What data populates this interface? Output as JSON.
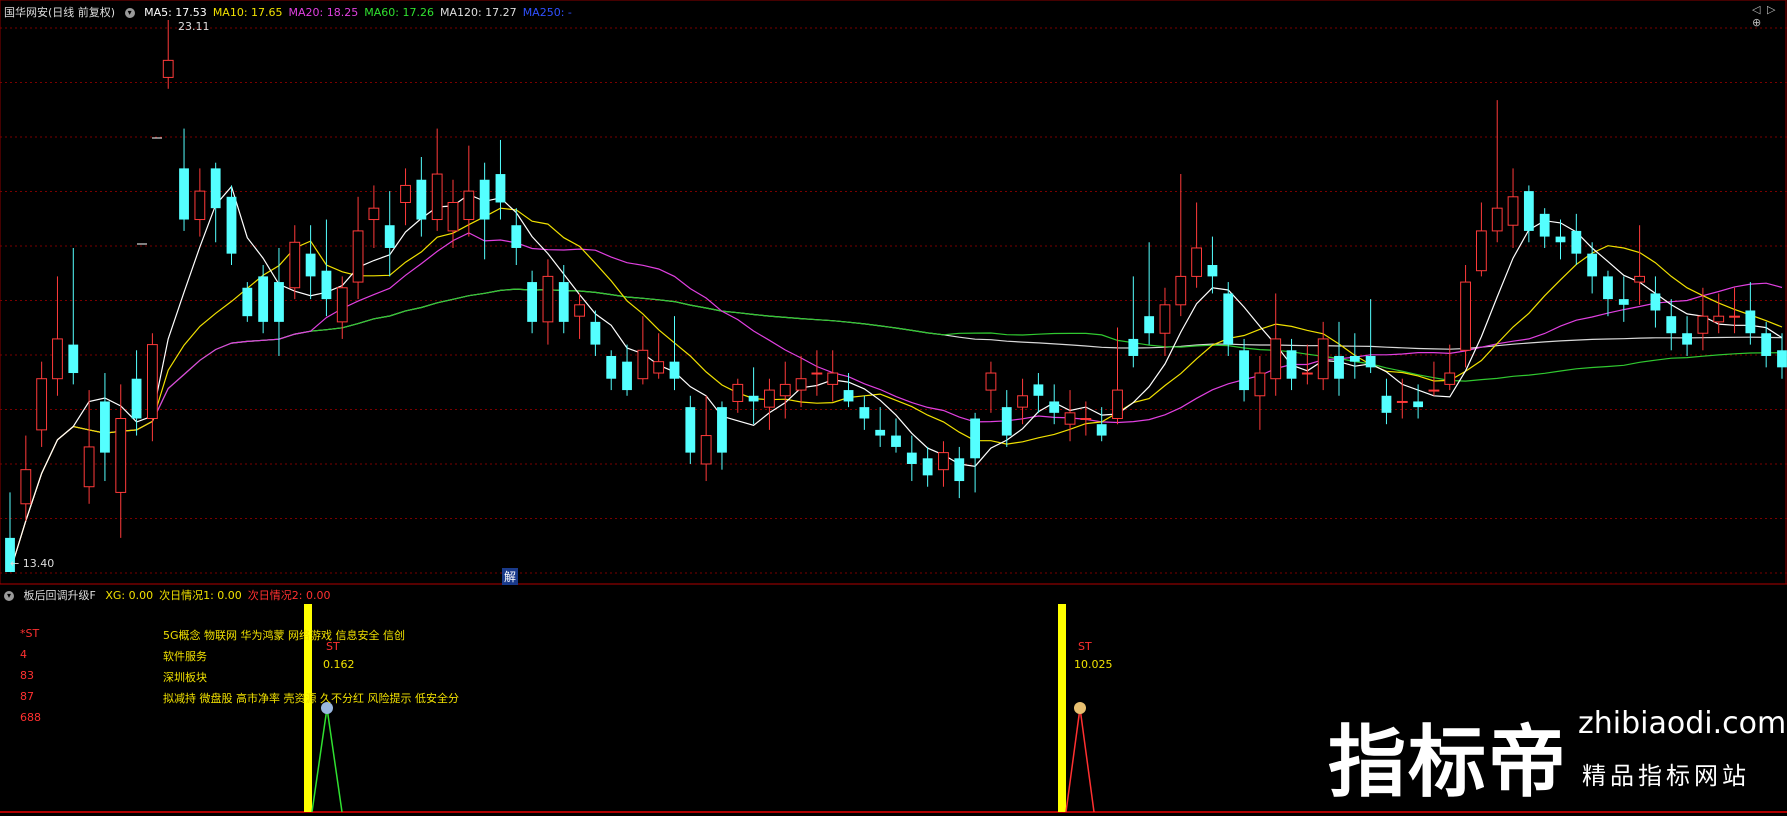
{
  "top_panel": {
    "stock_title": "国华网安(日线 前复权)",
    "ma_labels": [
      {
        "text": "MA5: 17.53",
        "color": "#ffffff"
      },
      {
        "text": "MA10: 17.65",
        "color": "#f0e000"
      },
      {
        "text": "MA20: 18.25",
        "color": "#e040e0"
      },
      {
        "text": "MA60: 17.26",
        "color": "#30e030"
      },
      {
        "text": "MA120: 17.27",
        "color": "#dddddd"
      },
      {
        "text": "MA250: -",
        "color": "#3050ff"
      }
    ],
    "high_label": "23.11",
    "low_label": "13.40",
    "jie_label": "解",
    "side_buttons": [
      "◁",
      "▷",
      "⊕"
    ]
  },
  "bottom_panel": {
    "indicator_title": "板后回调升级F",
    "indicator_values": [
      {
        "text": "XG: 0.00",
        "color": "#f0e000"
      },
      {
        "text": "次日情况1: 0.00",
        "color": "#f0e000"
      },
      {
        "text": "次日情况2: 0.00",
        "color": "#ff3030"
      }
    ],
    "left_info": [
      "*ST",
      "4",
      "83",
      "87",
      "688"
    ],
    "concepts": [
      "5G概念 物联网 华为鸿蒙 网络游戏 信息安全 信创",
      "软件服务",
      "深圳板块",
      "拟减持 微盘股 高市净率 壳资源 久不分红 风险提示 低安全分"
    ],
    "signals": [
      {
        "label": "ST",
        "value": "0.162"
      },
      {
        "label": "ST",
        "value": "10.025"
      }
    ]
  },
  "watermark": {
    "big_text": "指标帝",
    "url": "zhibiaodi.com",
    "sub_text": "精品指标网站"
  },
  "colors": {
    "up": "#ff3a3a",
    "down": "#54ffff",
    "ma5": "#ffffff",
    "ma10": "#f0e000",
    "ma20": "#e040e0",
    "ma60": "#30c830",
    "ma120": "#d8d8d8",
    "grid": "#7a0000",
    "signal_bar": "#ffff00"
  },
  "chart_data": {
    "type": "candlestick",
    "price_range": [
      13.4,
      23.11
    ],
    "candles": [
      [
        14.0,
        13.4,
        14.8,
        13.4
      ],
      [
        14.6,
        15.2,
        15.8,
        14.3
      ],
      [
        15.9,
        16.8,
        17.1,
        15.6
      ],
      [
        16.8,
        17.5,
        18.6,
        16.5
      ],
      [
        17.4,
        16.9,
        19.1,
        16.7
      ],
      [
        14.9,
        15.6,
        16.6,
        14.6
      ],
      [
        16.4,
        15.5,
        16.9,
        15.0
      ],
      [
        14.8,
        16.1,
        16.7,
        14.0
      ],
      [
        16.8,
        16.1,
        17.3,
        15.8
      ],
      [
        16.1,
        17.4,
        17.6,
        15.7
      ],
      [
        22.1,
        22.4,
        23.11,
        21.9
      ],
      [
        20.5,
        19.6,
        21.2,
        19.4
      ],
      [
        19.6,
        20.1,
        20.5,
        19.3
      ],
      [
        20.5,
        19.8,
        20.6,
        19.2
      ],
      [
        20.0,
        19.0,
        20.2,
        18.8
      ],
      [
        18.4,
        17.9,
        18.5,
        17.8
      ],
      [
        18.6,
        17.8,
        18.8,
        17.6
      ],
      [
        18.5,
        17.8,
        19.1,
        17.2
      ],
      [
        18.4,
        19.2,
        19.5,
        18.2
      ],
      [
        19.0,
        18.6,
        19.5,
        18.2
      ],
      [
        18.7,
        18.2,
        19.6,
        17.9
      ],
      [
        17.8,
        18.4,
        18.6,
        17.5
      ],
      [
        18.5,
        19.4,
        20.0,
        18.2
      ],
      [
        19.6,
        19.8,
        20.2,
        19.1
      ],
      [
        19.5,
        19.1,
        20.1,
        18.6
      ],
      [
        19.9,
        20.2,
        20.5,
        19.5
      ],
      [
        20.3,
        19.6,
        20.7,
        19.3
      ],
      [
        19.6,
        20.4,
        21.2,
        19.4
      ],
      [
        19.4,
        19.9,
        20.3,
        19.1
      ],
      [
        19.6,
        20.1,
        20.9,
        19.3
      ],
      [
        20.3,
        19.6,
        20.6,
        18.9
      ],
      [
        20.4,
        19.9,
        21.0,
        19.6
      ],
      [
        19.5,
        19.1,
        19.8,
        18.8
      ],
      [
        18.5,
        17.8,
        18.7,
        17.6
      ],
      [
        17.8,
        18.6,
        18.9,
        17.4
      ],
      [
        18.5,
        17.8,
        18.8,
        17.6
      ],
      [
        17.9,
        18.1,
        18.3,
        17.5
      ],
      [
        17.8,
        17.4,
        18.0,
        17.2
      ],
      [
        17.2,
        16.8,
        17.3,
        16.6
      ],
      [
        17.1,
        16.6,
        17.4,
        16.5
      ],
      [
        16.8,
        17.3,
        17.9,
        16.7
      ],
      [
        16.9,
        17.1,
        17.6,
        16.8
      ],
      [
        17.1,
        16.8,
        17.9,
        16.6
      ],
      [
        16.3,
        15.5,
        16.5,
        15.3
      ],
      [
        15.3,
        15.8,
        16.5,
        15.0
      ],
      [
        16.3,
        15.5,
        16.4,
        15.2
      ],
      [
        16.4,
        16.7,
        16.8,
        16.2
      ],
      [
        16.5,
        16.4,
        17.0,
        16.0
      ],
      [
        16.3,
        16.6,
        16.8,
        15.9
      ],
      [
        16.5,
        16.7,
        17.1,
        16.1
      ],
      [
        16.6,
        16.8,
        17.2,
        16.3
      ],
      [
        16.9,
        16.9,
        17.3,
        16.5
      ],
      [
        16.7,
        16.9,
        17.3,
        16.4
      ],
      [
        16.6,
        16.4,
        16.9,
        16.3
      ],
      [
        16.3,
        16.1,
        16.5,
        15.9
      ],
      [
        15.9,
        15.8,
        16.3,
        15.6
      ],
      [
        15.8,
        15.6,
        16.1,
        15.5
      ],
      [
        15.5,
        15.3,
        15.8,
        15.0
      ],
      [
        15.4,
        15.1,
        15.6,
        14.9
      ],
      [
        15.2,
        15.5,
        15.7,
        14.9
      ],
      [
        15.4,
        15.0,
        15.6,
        14.7
      ],
      [
        16.1,
        15.4,
        16.2,
        14.8
      ],
      [
        16.6,
        16.9,
        17.1,
        16.2
      ],
      [
        16.3,
        15.8,
        16.6,
        15.6
      ],
      [
        16.3,
        16.5,
        16.8,
        16.0
      ],
      [
        16.7,
        16.5,
        16.9,
        16.2
      ],
      [
        16.4,
        16.2,
        16.7,
        16.0
      ],
      [
        16.0,
        16.2,
        16.6,
        15.7
      ],
      [
        16.1,
        16.1,
        16.4,
        15.8
      ],
      [
        16.0,
        15.8,
        16.3,
        15.7
      ],
      [
        16.1,
        16.6,
        17.7,
        16.0
      ],
      [
        17.5,
        17.2,
        18.6,
        17.0
      ],
      [
        17.9,
        17.6,
        19.2,
        17.4
      ],
      [
        17.6,
        18.1,
        18.4,
        17.2
      ],
      [
        18.1,
        18.6,
        20.4,
        17.9
      ],
      [
        18.6,
        19.1,
        19.9,
        18.4
      ],
      [
        18.8,
        18.6,
        19.3,
        18.3
      ],
      [
        18.3,
        17.4,
        18.5,
        17.2
      ],
      [
        17.3,
        16.6,
        17.5,
        16.4
      ],
      [
        16.5,
        16.9,
        17.2,
        15.9
      ],
      [
        16.8,
        17.5,
        18.3,
        16.5
      ],
      [
        17.3,
        16.8,
        17.5,
        16.6
      ],
      [
        16.9,
        16.9,
        17.4,
        16.7
      ],
      [
        16.8,
        17.5,
        17.8,
        16.6
      ],
      [
        17.2,
        16.8,
        17.8,
        16.5
      ],
      [
        17.2,
        17.1,
        17.6,
        16.8
      ],
      [
        17.2,
        17.0,
        18.2,
        16.9
      ],
      [
        16.5,
        16.2,
        16.8,
        16.0
      ],
      [
        16.4,
        16.4,
        16.8,
        16.1
      ],
      [
        16.4,
        16.3,
        16.7,
        16.1
      ],
      [
        16.6,
        16.6,
        17.1,
        16.5
      ],
      [
        16.7,
        16.9,
        17.4,
        16.6
      ],
      [
        17.3,
        18.5,
        18.8,
        17.0
      ],
      [
        18.7,
        19.4,
        19.9,
        18.6
      ],
      [
        19.4,
        19.8,
        21.7,
        19.2
      ],
      [
        19.5,
        20.0,
        20.5,
        19.1
      ],
      [
        20.1,
        19.4,
        20.2,
        19.2
      ],
      [
        19.7,
        19.3,
        19.8,
        19.1
      ],
      [
        19.3,
        19.2,
        19.6,
        18.9
      ],
      [
        19.4,
        19.0,
        19.7,
        18.8
      ],
      [
        19.0,
        18.6,
        19.2,
        18.3
      ],
      [
        18.6,
        18.2,
        18.7,
        17.9
      ],
      [
        18.2,
        18.1,
        18.6,
        17.8
      ],
      [
        18.5,
        18.6,
        19.5,
        18.1
      ],
      [
        18.3,
        18.0,
        18.6,
        17.7
      ],
      [
        17.9,
        17.6,
        18.2,
        17.3
      ],
      [
        17.6,
        17.4,
        17.9,
        17.2
      ],
      [
        17.6,
        17.9,
        18.4,
        17.3
      ],
      [
        17.8,
        17.9,
        18.3,
        17.6
      ],
      [
        17.9,
        17.9,
        18.4,
        17.6
      ],
      [
        18.0,
        17.6,
        18.5,
        17.4
      ],
      [
        17.6,
        17.2,
        17.8,
        17.0
      ],
      [
        17.3,
        17.0,
        17.6,
        16.8
      ]
    ]
  }
}
